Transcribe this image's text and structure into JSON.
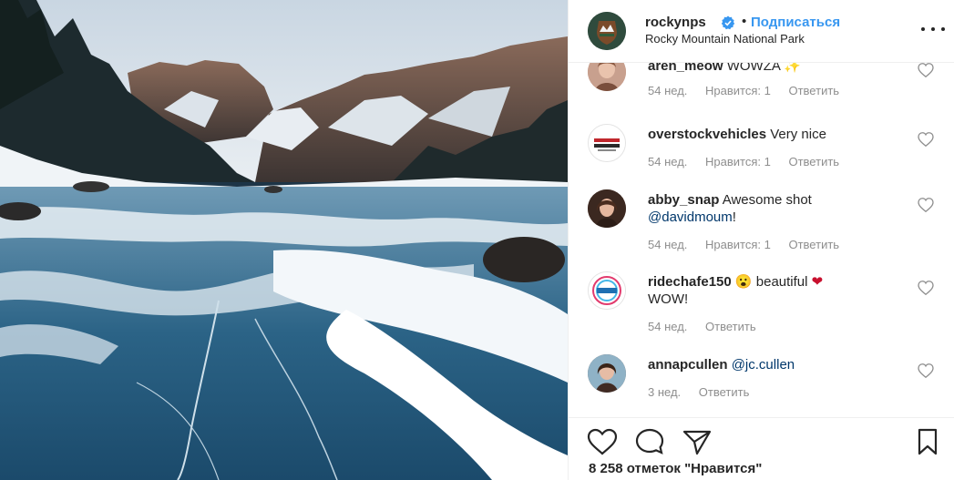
{
  "post": {
    "image_alt": "Frozen lake with mountains",
    "author": {
      "username": "rockynps",
      "verified": true,
      "follow_label": "Подписаться",
      "location": "Rocky Mountain National Park",
      "avatar_icon": "nps-arrowhead-logo"
    },
    "comments": [
      {
        "username": "aren_meow",
        "text": "WOWZA",
        "emoji": "sparkles",
        "age": "54 нед.",
        "likes": "Нравится: 1",
        "reply": "Ответить",
        "avatar_color": "#b07a66"
      },
      {
        "username": "overstockvehicles",
        "text": "Very nice",
        "emoji": "",
        "age": "54 нед.",
        "likes": "Нравится: 1",
        "reply": "Ответить",
        "avatar_color": "#f4f4f4"
      },
      {
        "username": "abby_snap",
        "text": "Awesome shot",
        "mention": "@davidmoum",
        "mention_suffix": "!",
        "age": "54 нед.",
        "likes": "Нравится: 1",
        "reply": "Ответить",
        "avatar_color": "#5a3a2c"
      },
      {
        "username": "ridechafe150",
        "text": "beautiful",
        "line2": "WOW!",
        "age": "54 нед.",
        "likes": "",
        "reply": "Ответить",
        "avatar_color": "#ffffff"
      },
      {
        "username": "annapcullen",
        "mention": "@jc.cullen",
        "age": "3 нед.",
        "likes": "",
        "reply": "Ответить",
        "avatar_color": "#6a4c3d"
      }
    ],
    "likes_text": "8 258 отметок \"Нравится\"",
    "colors": {
      "link_blue": "#3897f0",
      "mention_blue": "#00376b",
      "muted": "#8e8e8e",
      "heart_red": "#ed4956"
    }
  }
}
